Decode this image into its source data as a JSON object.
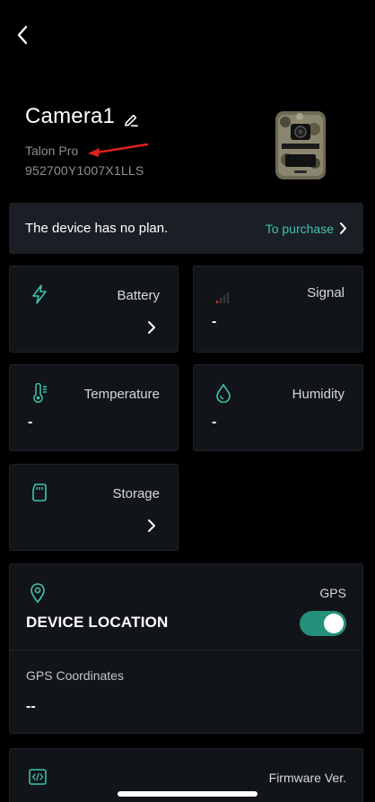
{
  "header": {
    "back_label": ""
  },
  "device": {
    "name": "Camera1",
    "model": "Talon Pro",
    "serial": "952700Y1007X1LLS"
  },
  "plan": {
    "message": "The device has no plan.",
    "action": "To purchase"
  },
  "cards": {
    "battery": {
      "title": "Battery",
      "icon": "lightning-icon"
    },
    "signal": {
      "title": "Signal",
      "value": "-",
      "icon": "signal-bars-icon"
    },
    "temperature": {
      "title": "Temperature",
      "value": "-",
      "icon": "thermometer-icon"
    },
    "humidity": {
      "title": "Humidity",
      "value": "-",
      "icon": "droplet-icon"
    },
    "storage": {
      "title": "Storage",
      "icon": "sd-card-icon"
    }
  },
  "gps": {
    "label": "GPS",
    "heading": "DEVICE LOCATION",
    "enabled": true,
    "coords_label": "GPS Coordinates",
    "coords_value": "--"
  },
  "firmware": {
    "label": "Firmware Ver."
  },
  "colors": {
    "accent": "#3ec5b0",
    "toggle_on": "#23917b",
    "card_bg": "#111418",
    "plan_bg": "#1a1f26"
  }
}
